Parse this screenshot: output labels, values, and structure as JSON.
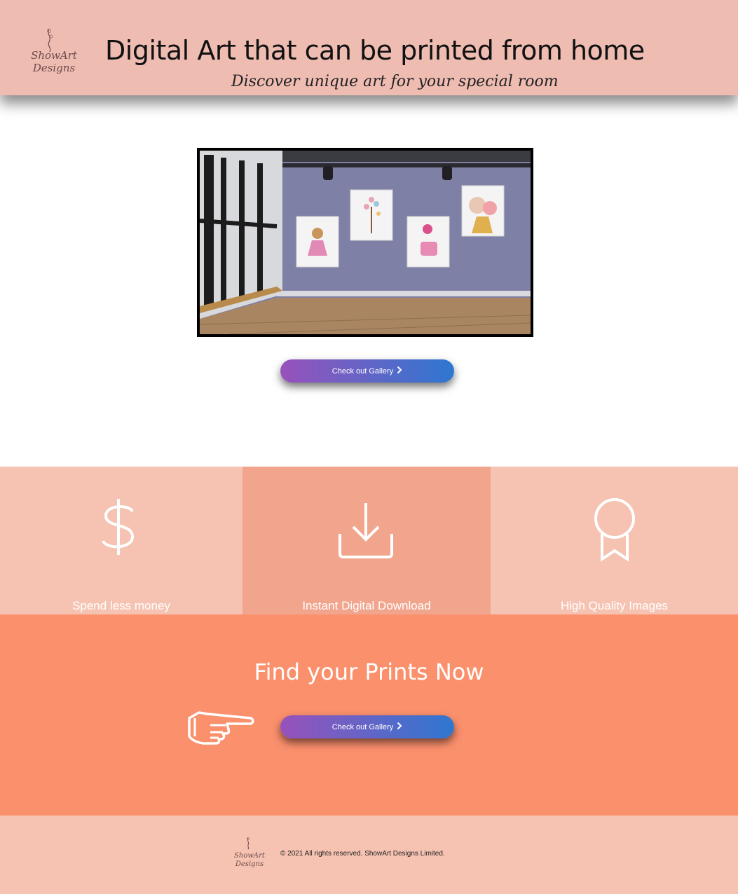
{
  "header": {
    "logo_text_line1": "ShowArt",
    "logo_text_line2": "Designs",
    "title": "Digital Art that can be printed from home",
    "subtitle": "Discover unique art for your special room"
  },
  "hero": {
    "button_label": "Check out Gallery",
    "button_icon": "chevron-right-icon"
  },
  "features": [
    {
      "label": "Spend less money",
      "icon": "dollar-icon",
      "color": "#f6c3b2"
    },
    {
      "label": "Instant Digital Download",
      "icon": "download-icon",
      "color": "#f2a58d"
    },
    {
      "label": "High Quality Images",
      "icon": "award-ribbon-icon",
      "color": "#f6c3b2"
    }
  ],
  "cta": {
    "title": "Find your Prints Now",
    "button_label": "Check out Gallery",
    "pointer_icon": "pointing-hand-icon"
  },
  "footer": {
    "logo_text_line1": "ShowArt",
    "logo_text_line2": "Designs",
    "copyright": "© 2021 All rights reserved. ShowArt Designs Limited."
  },
  "colors": {
    "header_bg": "#efbcb2",
    "cta_bg": "#fb906d",
    "footer_bg": "#f6c3b2",
    "button_gradient_start": "#9852bb",
    "button_gradient_end": "#2e77d1"
  }
}
